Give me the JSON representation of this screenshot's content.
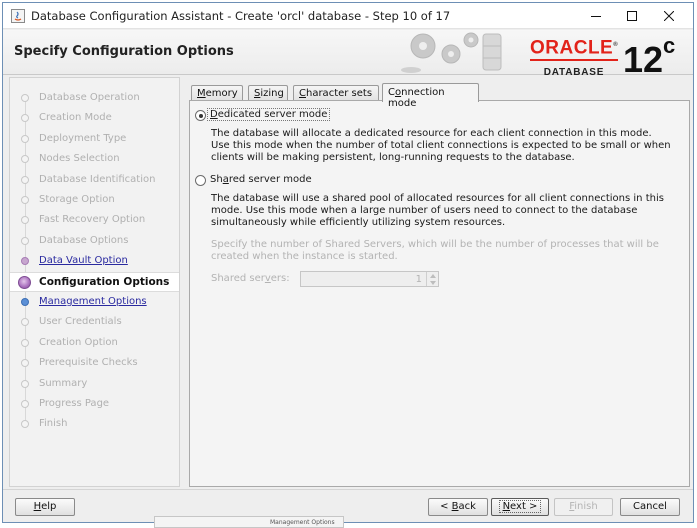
{
  "window": {
    "title": "Database Configuration Assistant - Create 'orcl' database - Step 10 of 17"
  },
  "header": {
    "page_title": "Specify Configuration Options",
    "logo_word": "ORACLE",
    "logo_registered": "®",
    "logo_sub": "DATABASE",
    "version_number": "12",
    "version_suffix": "c",
    "brand_color": "#e2231a"
  },
  "steps": [
    {
      "label": "Database Operation",
      "state": "inactive"
    },
    {
      "label": "Creation Mode",
      "state": "inactive"
    },
    {
      "label": "Deployment Type",
      "state": "inactive"
    },
    {
      "label": "Nodes Selection",
      "state": "inactive"
    },
    {
      "label": "Database Identification",
      "state": "inactive"
    },
    {
      "label": "Storage Option",
      "state": "inactive"
    },
    {
      "label": "Fast Recovery Option",
      "state": "inactive"
    },
    {
      "label": "Database Options",
      "state": "inactive"
    },
    {
      "label": "Data Vault Option",
      "state": "done"
    },
    {
      "label": "Configuration Options",
      "state": "current"
    },
    {
      "label": "Management Options",
      "state": "next"
    },
    {
      "label": "User Credentials",
      "state": "inactive"
    },
    {
      "label": "Creation Option",
      "state": "inactive"
    },
    {
      "label": "Prerequisite Checks",
      "state": "inactive"
    },
    {
      "label": "Summary",
      "state": "inactive"
    },
    {
      "label": "Progress Page",
      "state": "inactive"
    },
    {
      "label": "Finish",
      "state": "inactive"
    }
  ],
  "tabs": [
    {
      "pre": "",
      "acc": "M",
      "post": "emory"
    },
    {
      "pre": "",
      "acc": "S",
      "post": "izing"
    },
    {
      "pre": "",
      "acc": "C",
      "post": "haracter sets"
    },
    {
      "pre": "C",
      "acc": "o",
      "post": "nnection mode",
      "active": true
    }
  ],
  "connection_mode": {
    "dedicated": {
      "label_pre": "",
      "label_acc": "D",
      "label_post": "edicated server mode",
      "checked": true,
      "description": "The database will allocate a dedicated resource for each client connection in this mode. Use this mode when the number of total client connections is expected to be small or when clients will be making persistent, long-running requests to the database."
    },
    "shared": {
      "label_pre": "Sh",
      "label_acc": "a",
      "label_post": "red server mode",
      "checked": false,
      "description": "The database will use a shared pool of allocated resources for all client connections in this mode.  Use this mode when a large number of users need to connect to the database simultaneously while efficiently utilizing system resources.",
      "shared_servers_hint": "Specify the number of Shared Servers, which will be the number of processes that will be created when the instance is started.",
      "shared_servers_label_pre": "Shared ser",
      "shared_servers_label_acc": "v",
      "shared_servers_label_post": "ers:",
      "shared_servers_value": "1"
    }
  },
  "footer": {
    "help": {
      "pre": "",
      "acc": "H",
      "post": "elp"
    },
    "back": {
      "pre": "< ",
      "acc": "B",
      "post": "ack"
    },
    "next": {
      "pre": "",
      "acc": "N",
      "post": "ext >"
    },
    "finish": {
      "pre": "",
      "acc": "F",
      "post": "inish"
    },
    "cancel": "Cancel"
  },
  "taskbar_ghost_label": "Management Options"
}
